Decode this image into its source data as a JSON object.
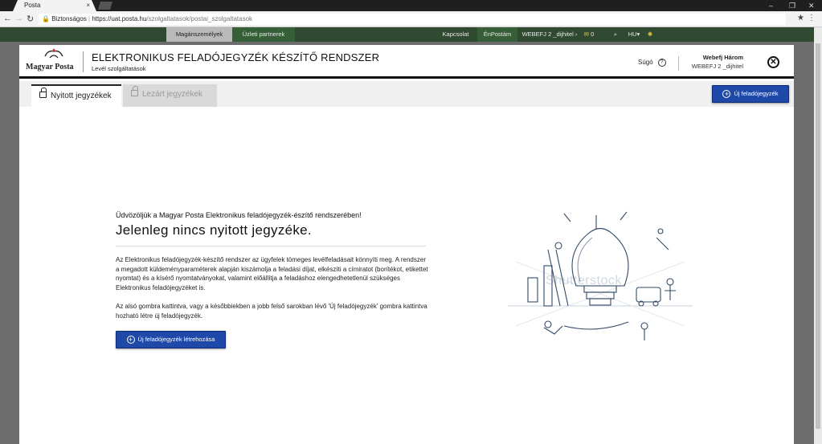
{
  "browser": {
    "tab_title": "Posta",
    "tab_close": "×",
    "secure_label": "Biztonságos",
    "url_host": "https://uat.posta.hu",
    "url_path": "/szolgaltatasok/postai_szolgaltatasok",
    "window_controls": [
      "–",
      "❐",
      "✕"
    ]
  },
  "topnav": {
    "private": "Magánszemélyek",
    "business": "Üzleti partnerek",
    "contact": "Kapcsolat",
    "enposta": "ÉnPostám",
    "user": "WEBEFJ 2 _dijhitel",
    "mail_count": "0",
    "lang": "HU"
  },
  "modal": {
    "logo_text": "Magyar Posta",
    "title": "ELEKTRONIKUS FELADÓJEGYZÉK KÉSZÍTŐ RENDSZER",
    "subtitle": "Levél szolgáltatások",
    "help_label": "Súgó",
    "user_name": "Webefj Három",
    "user_account": "WEBEFJ 2 _dijhitel",
    "close_symbol": "✕"
  },
  "tabs": {
    "open": "Nyitott jegyzékek",
    "closed": "Lezárt jegyzékek",
    "new_button": "Új feladójegyzék"
  },
  "content": {
    "welcome": "Üdvözöljük a Magyar Posta Elektronikus feladójegyzék-észítő rendszerében!",
    "headline": "Jelenleg nincs nyitott jegyzéke.",
    "paragraph1": "Az Elektronikus feladójegyzék-készítő rendszer az ügyfelek tömeges levélfeladásait könnyíti meg. A rendszer a megadott küldeményparaméterek alapján kiszámolja a feladási díjat, elkészíti a címiratot (borítékot, etikettet nyomtat) és a kísérő nyomtatványokat, valamint előállítja a feladáshoz elengedhetetlenül szükséges Elektronikus feladójegyzéket is.",
    "paragraph2": "Az alsó gombra kattintva, vagy a későbbiekben a jobb felső sarokban lévő 'Új feladójegyzék' gombra kattintva hozható létre új feladójegyzék.",
    "create_button": "Új feladójegyzék létrehozása",
    "watermark": "Shutterstock"
  },
  "colors": {
    "posta_green": "#2f4a30",
    "accent_blue": "#1e49a8",
    "gear_yellow": "#e1c54a"
  },
  "icons": [
    "lock-icon",
    "plus-circle-icon",
    "help-icon",
    "close-icon",
    "search-icon",
    "mail-icon",
    "gear-icon",
    "star-icon",
    "reload-icon",
    "back-icon",
    "forward-icon"
  ]
}
